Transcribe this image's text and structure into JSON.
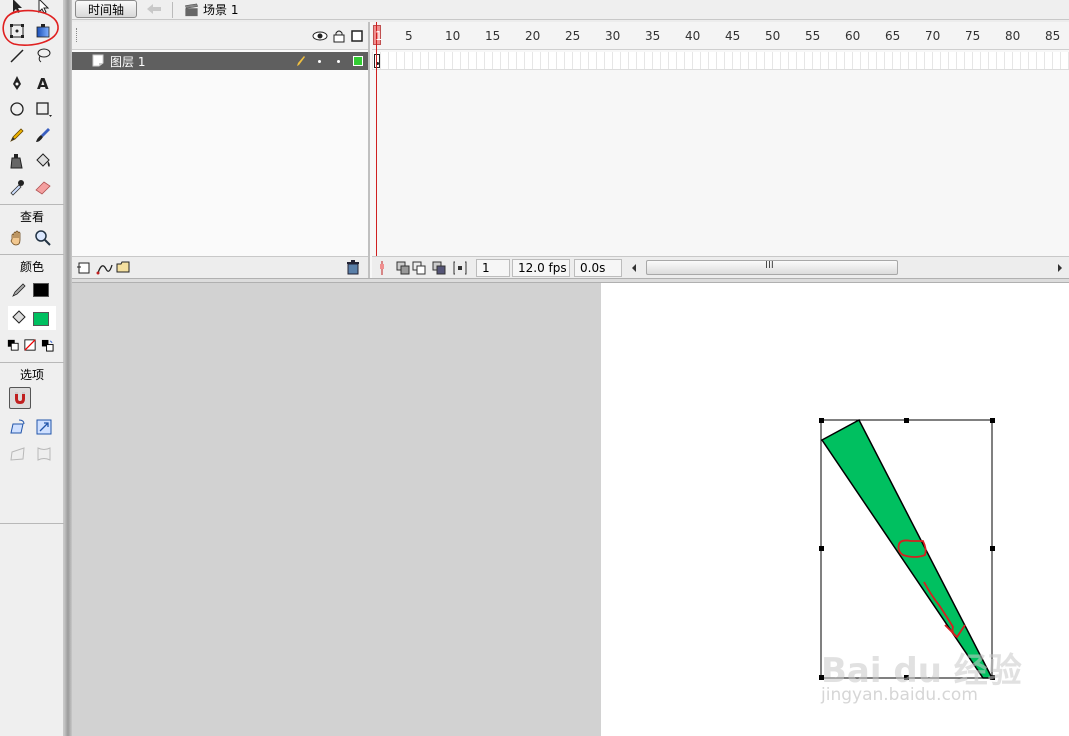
{
  "header": {
    "timeline_button": "时间轴",
    "scene_label": "场景 1"
  },
  "toolbox": {
    "view_label": "查看",
    "color_label": "颜色",
    "options_label": "选项",
    "stroke_color": "#000000",
    "fill_color": "#00c060"
  },
  "timeline": {
    "layer_name": "图层 1",
    "ruler_labels": [
      "1",
      "5",
      "10",
      "15",
      "20",
      "25",
      "30",
      "35",
      "40",
      "45",
      "50",
      "55",
      "60",
      "65",
      "70",
      "75",
      "80",
      "85"
    ],
    "current_frame": "1",
    "frame_rate": "12.0 fps",
    "elapsed_time": "0.0s",
    "scroll_grip": "III",
    "layer_color": "#33cc33"
  },
  "stage": {
    "shape_fill": "#00c060",
    "annotation_color": "#d42020"
  },
  "watermark": {
    "brand": "Bai du 经验",
    "url": "jingyan.baidu.com"
  }
}
